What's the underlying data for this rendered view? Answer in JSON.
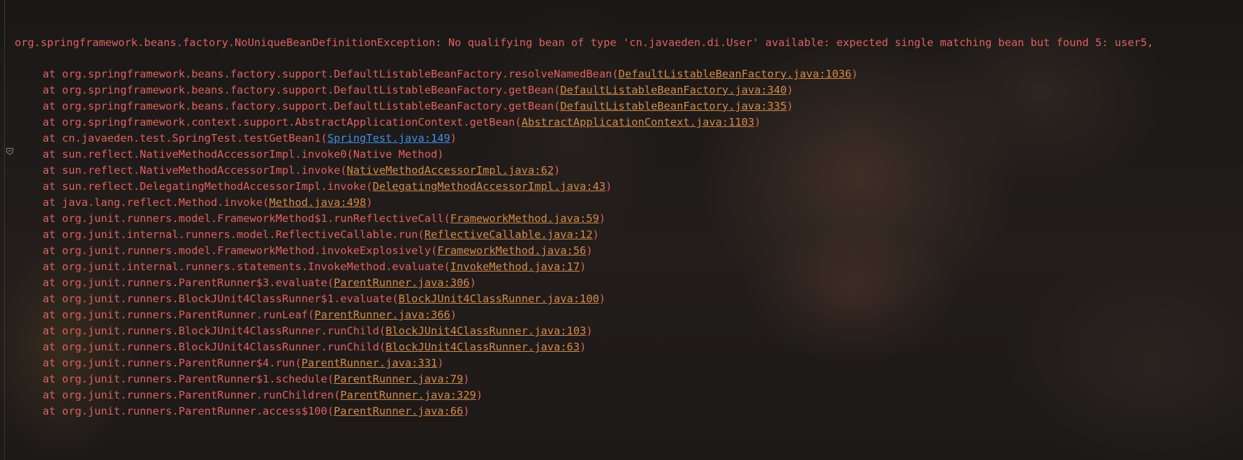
{
  "console": {
    "header": "org.springframework.beans.factory.NoUniqueBeanDefinitionException: No qualifying bean of type 'cn.javaeden.di.User' available: expected single matching bean but found 5: user5,",
    "frames": [
      {
        "prefix": "at org.springframework.beans.factory.support.DefaultListableBeanFactory.resolveNamedBean(",
        "link": "DefaultListableBeanFactory.java:1036",
        "suffix": ")",
        "link_type": "orange"
      },
      {
        "prefix": "at org.springframework.beans.factory.support.DefaultListableBeanFactory.getBean(",
        "link": "DefaultListableBeanFactory.java:340",
        "suffix": ")",
        "link_type": "orange"
      },
      {
        "prefix": "at org.springframework.beans.factory.support.DefaultListableBeanFactory.getBean(",
        "link": "DefaultListableBeanFactory.java:335",
        "suffix": ")",
        "link_type": "orange"
      },
      {
        "prefix": "at org.springframework.context.support.AbstractApplicationContext.getBean(",
        "link": "AbstractApplicationContext.java:1103",
        "suffix": ")",
        "link_type": "orange"
      },
      {
        "prefix": "at cn.javaeden.test.SpringTest.testGetBean1(",
        "link": "SpringTest.java:149",
        "suffix": ")",
        "link_type": "blue"
      },
      {
        "prefix": "at sun.reflect.NativeMethodAccessorImpl.invoke0(Native Method)",
        "link": "",
        "suffix": "",
        "link_type": "none"
      },
      {
        "prefix": "at sun.reflect.NativeMethodAccessorImpl.invoke(",
        "link": "NativeMethodAccessorImpl.java:62",
        "suffix": ")",
        "link_type": "orange"
      },
      {
        "prefix": "at sun.reflect.DelegatingMethodAccessorImpl.invoke(",
        "link": "DelegatingMethodAccessorImpl.java:43",
        "suffix": ")",
        "link_type": "orange"
      },
      {
        "prefix": "at java.lang.reflect.Method.invoke(",
        "link": "Method.java:498",
        "suffix": ")",
        "link_type": "orange"
      },
      {
        "prefix": "at org.junit.runners.model.FrameworkMethod$1.runReflectiveCall(",
        "link": "FrameworkMethod.java:59",
        "suffix": ")",
        "link_type": "orange"
      },
      {
        "prefix": "at org.junit.internal.runners.model.ReflectiveCallable.run(",
        "link": "ReflectiveCallable.java:12",
        "suffix": ")",
        "link_type": "orange"
      },
      {
        "prefix": "at org.junit.runners.model.FrameworkMethod.invokeExplosively(",
        "link": "FrameworkMethod.java:56",
        "suffix": ")",
        "link_type": "orange"
      },
      {
        "prefix": "at org.junit.internal.runners.statements.InvokeMethod.evaluate(",
        "link": "InvokeMethod.java:17",
        "suffix": ")",
        "link_type": "orange"
      },
      {
        "prefix": "at org.junit.runners.ParentRunner$3.evaluate(",
        "link": "ParentRunner.java:306",
        "suffix": ")",
        "link_type": "orange"
      },
      {
        "prefix": "at org.junit.runners.BlockJUnit4ClassRunner$1.evaluate(",
        "link": "BlockJUnit4ClassRunner.java:100",
        "suffix": ")",
        "link_type": "orange"
      },
      {
        "prefix": "at org.junit.runners.ParentRunner.runLeaf(",
        "link": "ParentRunner.java:366",
        "suffix": ")",
        "link_type": "orange"
      },
      {
        "prefix": "at org.junit.runners.BlockJUnit4ClassRunner.runChild(",
        "link": "BlockJUnit4ClassRunner.java:103",
        "suffix": ")",
        "link_type": "orange"
      },
      {
        "prefix": "at org.junit.runners.BlockJUnit4ClassRunner.runChild(",
        "link": "BlockJUnit4ClassRunner.java:63",
        "suffix": ")",
        "link_type": "orange"
      },
      {
        "prefix": "at org.junit.runners.ParentRunner$4.run(",
        "link": "ParentRunner.java:331",
        "suffix": ")",
        "link_type": "orange"
      },
      {
        "prefix": "at org.junit.runners.ParentRunner$1.schedule(",
        "link": "ParentRunner.java:79",
        "suffix": ")",
        "link_type": "orange"
      },
      {
        "prefix": "at org.junit.runners.ParentRunner.runChildren(",
        "link": "ParentRunner.java:329",
        "suffix": ")",
        "link_type": "orange"
      },
      {
        "prefix": "at org.junit.runners.ParentRunner.access$100(",
        "link": "ParentRunner.java:66",
        "suffix": ")",
        "link_type": "orange"
      }
    ]
  },
  "colors": {
    "error_text": "#e0605a",
    "link_orange": "#d68a45",
    "link_blue": "#3d8fe8"
  },
  "icons": {
    "fold_marker": "fold-marker-icon"
  }
}
